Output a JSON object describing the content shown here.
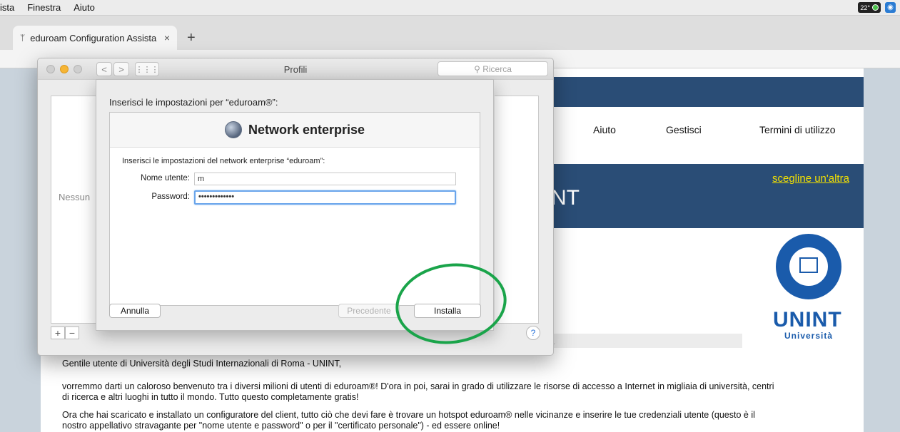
{
  "menubar": {
    "items": [
      "ista",
      "Finestra",
      "Aiuto"
    ],
    "temperature": "22°"
  },
  "browser": {
    "tab_title": "eduroam Configuration Assista",
    "tab_close": "×",
    "new_tab": "+"
  },
  "webpage": {
    "nav": [
      "Aiuto",
      "Gestisci",
      "Termini di utilizzo"
    ],
    "banner_partial": "NT",
    "choose_other_link": "scegline un'altra",
    "logo_text": "UNINT",
    "logo_subtext": "Università",
    "strip_fragment": ".",
    "greeting": "Gentile utente di Università degli Studi Internazionali di Roma - UNINT,",
    "para1": "vorremmo darti un caloroso benvenuto tra i diversi milioni di utenti di eduroam®! D'ora in poi, sarai in grado di utilizzare le risorse di accesso a Internet in migliaia di università, centri di ricerca e altri luoghi in tutto il mondo. Tutto questo completamente gratis!",
    "para2": "Ora che hai scaricato e installato un configuratore del client, tutto ciò che devi fare è trovare un hotspot eduroam® nelle vicinanze e inserire le tue credenziali utente (questo è il nostro appellativo stravagante per \"nome utente e password\" o per il \"certificato personale\") - ed essere online!"
  },
  "sysprefs": {
    "title": "Profili",
    "search_placeholder": "Ricerca",
    "back": "<",
    "forward": ">",
    "grid": "⋮⋮⋮",
    "empty_label": "Nessun",
    "add": "+",
    "remove": "−",
    "help": "?"
  },
  "sheet": {
    "heading": "Inserisci le impostazioni per “eduroam®”:",
    "title": "Network enterprise",
    "description": "Inserisci le impostazioni del network enterprise “eduroam”:",
    "username_label": "Nome utente:",
    "username_value": "m            ",
    "password_label": "Password:",
    "password_value": "•••••••••••••",
    "cancel": "Annulla",
    "previous": "Precedente",
    "install": "Installa"
  },
  "colors": {
    "web_band": "#2a4d76",
    "link_yellow": "#f3e000",
    "annotation_green": "#1aa44a",
    "focus_blue": "#6aa5eb"
  }
}
